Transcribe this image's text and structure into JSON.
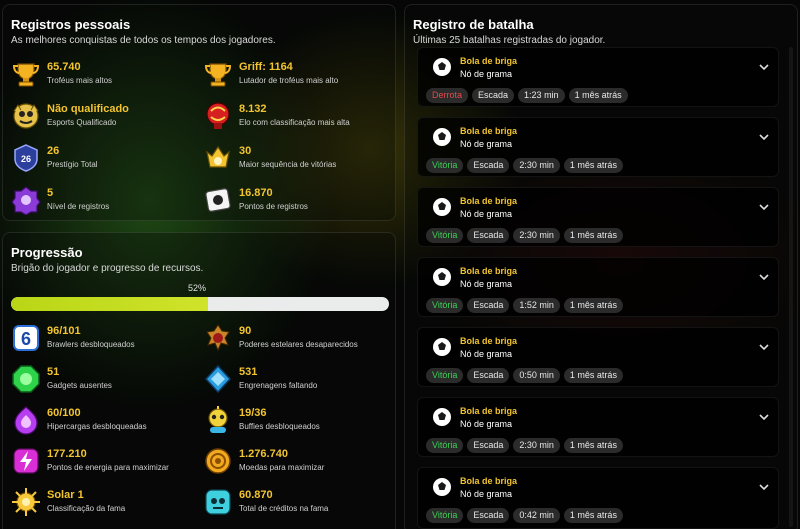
{
  "records": {
    "title": "Registros pessoais",
    "subtitle": "As melhores conquistas de todos os tempos dos jogadores.",
    "items": [
      {
        "value": "65.740",
        "label": "Troféus mais altos",
        "icon": "trophy-icon"
      },
      {
        "value": "Griff: 1164",
        "label": "Lutador de troféus mais alto",
        "icon": "brawler-trophy-icon"
      },
      {
        "value": "Não qualificado",
        "label": "Esports Qualificado",
        "icon": "esports-icon"
      },
      {
        "value": "8.132",
        "label": "Elo com classificação mais alta",
        "icon": "ranked-elo-icon"
      },
      {
        "value": "26",
        "label": "Prestígio Total",
        "icon": "prestige-icon"
      },
      {
        "value": "30",
        "label": "Maior sequência de vitórias",
        "icon": "win-streak-icon"
      },
      {
        "value": "5",
        "label": "Nível de registros",
        "icon": "records-level-icon"
      },
      {
        "value": "16.870",
        "label": "Pontos de registros",
        "icon": "records-points-icon"
      }
    ]
  },
  "progress": {
    "title": "Progressão",
    "subtitle": "Brigão do jogador e progresso de recursos.",
    "percent_label": "52%",
    "percent": 0.52,
    "items": [
      {
        "value": "96/101",
        "label": "Brawlers desbloqueados",
        "icon": "brawlers-icon"
      },
      {
        "value": "90",
        "label": "Poderes estelares desaparecidos",
        "icon": "star-power-icon"
      },
      {
        "value": "51",
        "label": "Gadgets ausentes",
        "icon": "gadget-icon"
      },
      {
        "value": "531",
        "label": "Engrenagens faltando",
        "icon": "gear-icon"
      },
      {
        "value": "60/100",
        "label": "Hipercargas desbloqueadas",
        "icon": "hypercharge-icon"
      },
      {
        "value": "19/36",
        "label": "Buffies desbloqueados",
        "icon": "buffies-icon"
      },
      {
        "value": "177.210",
        "label": "Pontos de energia para maximizar",
        "icon": "power-points-icon"
      },
      {
        "value": "1.276.740",
        "label": "Moedas para maximizar",
        "icon": "coins-icon"
      },
      {
        "value": "Solar 1",
        "label": "Classificação da fama",
        "icon": "fame-icon"
      },
      {
        "value": "60.870",
        "label": "Total de créditos na fama",
        "icon": "fame-credits-icon"
      }
    ]
  },
  "battles": {
    "title": "Registro de batalha",
    "subtitle": "Últimas 25 batalhas registradas do jogador.",
    "items": [
      {
        "mode": "Bola de briga",
        "map": "Nó de grama",
        "result": "Derrota",
        "result_type": "loss",
        "role": "Escada",
        "duration": "1:23 min",
        "when": "1 mês atrás"
      },
      {
        "mode": "Bola de briga",
        "map": "Nó de grama",
        "result": "Vitória",
        "result_type": "win",
        "role": "Escada",
        "duration": "2:30 min",
        "when": "1 mês atrás"
      },
      {
        "mode": "Bola de briga",
        "map": "Nó de grama",
        "result": "Vitória",
        "result_type": "win",
        "role": "Escada",
        "duration": "2:30 min",
        "when": "1 mês atrás"
      },
      {
        "mode": "Bola de briga",
        "map": "Nó de grama",
        "result": "Vitória",
        "result_type": "win",
        "role": "Escada",
        "duration": "1:52 min",
        "when": "1 mês atrás"
      },
      {
        "mode": "Bola de briga",
        "map": "Nó de grama",
        "result": "Vitória",
        "result_type": "win",
        "role": "Escada",
        "duration": "0:50 min",
        "when": "1 mês atrás"
      },
      {
        "mode": "Bola de briga",
        "map": "Nó de grama",
        "result": "Vitória",
        "result_type": "win",
        "role": "Escada",
        "duration": "2:30 min",
        "when": "1 mês atrás"
      },
      {
        "mode": "Bola de briga",
        "map": "Nó de grama",
        "result": "Vitória",
        "result_type": "win",
        "role": "Escada",
        "duration": "0:42 min",
        "when": "1 mês atrás"
      }
    ]
  },
  "colors": {
    "accent_gold": "#f2c430",
    "progress_fill": "#c4dc1e",
    "win": "#3ccf55",
    "loss": "#e44b4b"
  }
}
